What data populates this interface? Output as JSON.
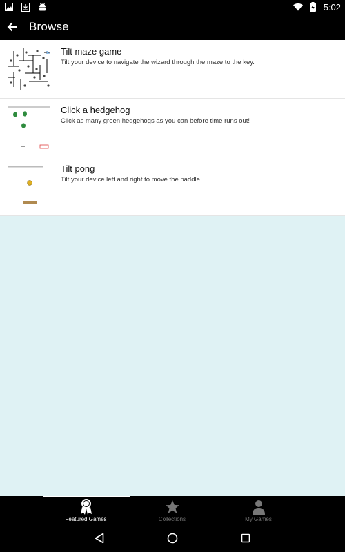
{
  "status_bar": {
    "time": "5:02",
    "left_icons": [
      "image-icon",
      "download-icon",
      "android-icon"
    ],
    "right_icons": [
      "wifi-icon",
      "battery-charging-icon"
    ]
  },
  "app_bar": {
    "title": "Browse",
    "back_icon": "arrow-left-icon"
  },
  "games": [
    {
      "title": "Tilt maze game",
      "description": "Tilt your device to navigate the wizard through the maze to the key."
    },
    {
      "title": "Click a hedgehog",
      "description": "Click as many green hedgehogs as you can before time runs out!"
    },
    {
      "title": "Tilt pong",
      "description": "Tilt your device left and right to move the paddle."
    }
  ],
  "tabs": [
    {
      "label": "Featured Games",
      "icon": "award-icon",
      "active": true
    },
    {
      "label": "Collections",
      "icon": "star-icon",
      "active": false
    },
    {
      "label": "My Games",
      "icon": "person-icon",
      "active": false
    }
  ],
  "nav_bar": {
    "icons": [
      "back-triangle-icon",
      "home-circle-icon",
      "recents-square-icon"
    ]
  },
  "colors": {
    "background_content": "#dff2f4",
    "bars": "#000000",
    "hedgehog_green": "#2e8b3d",
    "tab_inactive": "#777777"
  }
}
